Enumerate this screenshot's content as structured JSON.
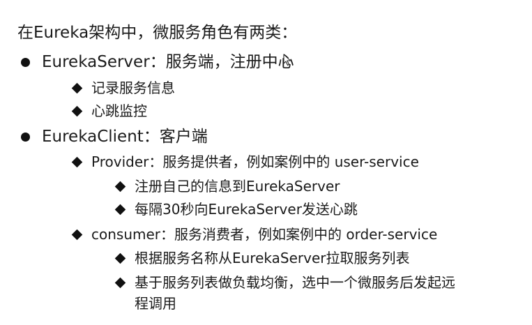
{
  "title": "在Eureka架构中，微服务角色有两类：",
  "items": [
    {
      "label": "EurekaServer：服务端，注册中心",
      "children": [
        {
          "label": "记录服务信息"
        },
        {
          "label": "心跳监控"
        }
      ]
    },
    {
      "label": "EurekaClient：客户端",
      "children": [
        {
          "label": "Provider：服务提供者，例如案例中的 user-service",
          "children": [
            {
              "label": "注册自己的信息到EurekaServer"
            },
            {
              "label": "每隔30秒向EurekaServer发送心跳"
            }
          ]
        },
        {
          "label": "consumer：服务消费者，例如案例中的 order-service",
          "children": [
            {
              "label": "根据服务名称从EurekaServer拉取服务列表"
            },
            {
              "label": "基于服务列表做负载均衡，选中一个微服务后发起远",
              "continuation": "程调用"
            }
          ]
        }
      ]
    }
  ]
}
